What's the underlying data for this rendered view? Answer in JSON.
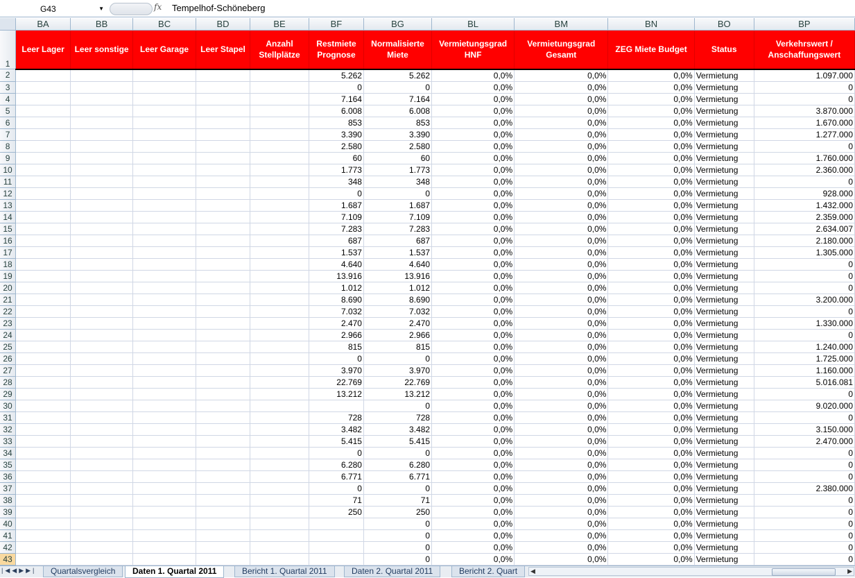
{
  "formula_bar": {
    "name_box": "G43",
    "fx_label": "fx",
    "formula_value": "Tempelhof-Schöneberg"
  },
  "columns": [
    {
      "letter": "BA",
      "header": "Leer Lager",
      "type": "txt"
    },
    {
      "letter": "BB",
      "header": "Leer sonstige",
      "type": "txt"
    },
    {
      "letter": "BC",
      "header": "Leer Garage",
      "type": "txt"
    },
    {
      "letter": "BD",
      "header": "Leer Stapel",
      "type": "txt"
    },
    {
      "letter": "BE",
      "header": "Anzahl Stellplätze",
      "type": "txt"
    },
    {
      "letter": "BF",
      "header": "Restmiete Prognose",
      "type": "num"
    },
    {
      "letter": "BG",
      "header": "Normalisierte Miete",
      "type": "num"
    },
    {
      "letter": "BL",
      "header": "Vermietungsgrad HNF",
      "type": "num"
    },
    {
      "letter": "BM",
      "header": "Vermietungsgrad Gesamt",
      "type": "num"
    },
    {
      "letter": "BN",
      "header": "ZEG Miete Budget",
      "type": "num"
    },
    {
      "letter": "BO",
      "header": "Status",
      "type": "txt"
    },
    {
      "letter": "BP",
      "header": "Verkehrswert / Anschaffungswert",
      "type": "num"
    }
  ],
  "header_row_number": "1",
  "rows": [
    {
      "n": "2",
      "bf": "5.262",
      "bg": "5.262",
      "bl": "0,0%",
      "bm": "0,0%",
      "bn": "0,0%",
      "bo": "Vermietung",
      "bp": "1.097.000"
    },
    {
      "n": "3",
      "bf": "0",
      "bg": "0",
      "bl": "0,0%",
      "bm": "0,0%",
      "bn": "0,0%",
      "bo": "Vermietung",
      "bp": "0"
    },
    {
      "n": "4",
      "bf": "7.164",
      "bg": "7.164",
      "bl": "0,0%",
      "bm": "0,0%",
      "bn": "0,0%",
      "bo": "Vermietung",
      "bp": "0"
    },
    {
      "n": "5",
      "bf": "6.008",
      "bg": "6.008",
      "bl": "0,0%",
      "bm": "0,0%",
      "bn": "0,0%",
      "bo": "Vermietung",
      "bp": "3.870.000"
    },
    {
      "n": "6",
      "bf": "853",
      "bg": "853",
      "bl": "0,0%",
      "bm": "0,0%",
      "bn": "0,0%",
      "bo": "Vermietung",
      "bp": "1.670.000"
    },
    {
      "n": "7",
      "bf": "3.390",
      "bg": "3.390",
      "bl": "0,0%",
      "bm": "0,0%",
      "bn": "0,0%",
      "bo": "Vermietung",
      "bp": "1.277.000"
    },
    {
      "n": "8",
      "bf": "2.580",
      "bg": "2.580",
      "bl": "0,0%",
      "bm": "0,0%",
      "bn": "0,0%",
      "bo": "Vermietung",
      "bp": "0"
    },
    {
      "n": "9",
      "bf": "60",
      "bg": "60",
      "bl": "0,0%",
      "bm": "0,0%",
      "bn": "0,0%",
      "bo": "Vermietung",
      "bp": "1.760.000"
    },
    {
      "n": "10",
      "bf": "1.773",
      "bg": "1.773",
      "bl": "0,0%",
      "bm": "0,0%",
      "bn": "0,0%",
      "bo": "Vermietung",
      "bp": "2.360.000"
    },
    {
      "n": "11",
      "bf": "348",
      "bg": "348",
      "bl": "0,0%",
      "bm": "0,0%",
      "bn": "0,0%",
      "bo": "Vermietung",
      "bp": "0"
    },
    {
      "n": "12",
      "bf": "0",
      "bg": "0",
      "bl": "0,0%",
      "bm": "0,0%",
      "bn": "0,0%",
      "bo": "Vermietung",
      "bp": "928.000"
    },
    {
      "n": "13",
      "bf": "1.687",
      "bg": "1.687",
      "bl": "0,0%",
      "bm": "0,0%",
      "bn": "0,0%",
      "bo": "Vermietung",
      "bp": "1.432.000"
    },
    {
      "n": "14",
      "bf": "7.109",
      "bg": "7.109",
      "bl": "0,0%",
      "bm": "0,0%",
      "bn": "0,0%",
      "bo": "Vermietung",
      "bp": "2.359.000"
    },
    {
      "n": "15",
      "bf": "7.283",
      "bg": "7.283",
      "bl": "0,0%",
      "bm": "0,0%",
      "bn": "0,0%",
      "bo": "Vermietung",
      "bp": "2.634.007"
    },
    {
      "n": "16",
      "bf": "687",
      "bg": "687",
      "bl": "0,0%",
      "bm": "0,0%",
      "bn": "0,0%",
      "bo": "Vermietung",
      "bp": "2.180.000"
    },
    {
      "n": "17",
      "bf": "1.537",
      "bg": "1.537",
      "bl": "0,0%",
      "bm": "0,0%",
      "bn": "0,0%",
      "bo": "Vermietung",
      "bp": "1.305.000"
    },
    {
      "n": "18",
      "bf": "4.640",
      "bg": "4.640",
      "bl": "0,0%",
      "bm": "0,0%",
      "bn": "0,0%",
      "bo": "Vermietung",
      "bp": "0"
    },
    {
      "n": "19",
      "bf": "13.916",
      "bg": "13.916",
      "bl": "0,0%",
      "bm": "0,0%",
      "bn": "0,0%",
      "bo": "Vermietung",
      "bp": "0"
    },
    {
      "n": "20",
      "bf": "1.012",
      "bg": "1.012",
      "bl": "0,0%",
      "bm": "0,0%",
      "bn": "0,0%",
      "bo": "Vermietung",
      "bp": "0"
    },
    {
      "n": "21",
      "bf": "8.690",
      "bg": "8.690",
      "bl": "0,0%",
      "bm": "0,0%",
      "bn": "0,0%",
      "bo": "Vermietung",
      "bp": "3.200.000"
    },
    {
      "n": "22",
      "bf": "7.032",
      "bg": "7.032",
      "bl": "0,0%",
      "bm": "0,0%",
      "bn": "0,0%",
      "bo": "Vermietung",
      "bp": "0"
    },
    {
      "n": "23",
      "bf": "2.470",
      "bg": "2.470",
      "bl": "0,0%",
      "bm": "0,0%",
      "bn": "0,0%",
      "bo": "Vermietung",
      "bp": "1.330.000"
    },
    {
      "n": "24",
      "bf": "2.966",
      "bg": "2.966",
      "bl": "0,0%",
      "bm": "0,0%",
      "bn": "0,0%",
      "bo": "Vermietung",
      "bp": "0"
    },
    {
      "n": "25",
      "bf": "815",
      "bg": "815",
      "bl": "0,0%",
      "bm": "0,0%",
      "bn": "0,0%",
      "bo": "Vermietung",
      "bp": "1.240.000"
    },
    {
      "n": "26",
      "bf": "0",
      "bg": "0",
      "bl": "0,0%",
      "bm": "0,0%",
      "bn": "0,0%",
      "bo": "Vermietung",
      "bp": "1.725.000"
    },
    {
      "n": "27",
      "bf": "3.970",
      "bg": "3.970",
      "bl": "0,0%",
      "bm": "0,0%",
      "bn": "0,0%",
      "bo": "Vermietung",
      "bp": "1.160.000"
    },
    {
      "n": "28",
      "bf": "22.769",
      "bg": "22.769",
      "bl": "0,0%",
      "bm": "0,0%",
      "bn": "0,0%",
      "bo": "Vermietung",
      "bp": "5.016.081"
    },
    {
      "n": "29",
      "bf": "13.212",
      "bg": "13.212",
      "bl": "0,0%",
      "bm": "0,0%",
      "bn": "0,0%",
      "bo": "Vermietung",
      "bp": "0"
    },
    {
      "n": "30",
      "bf": "",
      "bg": "0",
      "bl": "0,0%",
      "bm": "0,0%",
      "bn": "0,0%",
      "bo": "Vermietung",
      "bp": "9.020.000"
    },
    {
      "n": "31",
      "bf": "728",
      "bg": "728",
      "bl": "0,0%",
      "bm": "0,0%",
      "bn": "0,0%",
      "bo": "Vermietung",
      "bp": "0"
    },
    {
      "n": "32",
      "bf": "3.482",
      "bg": "3.482",
      "bl": "0,0%",
      "bm": "0,0%",
      "bn": "0,0%",
      "bo": "Vermietung",
      "bp": "3.150.000"
    },
    {
      "n": "33",
      "bf": "5.415",
      "bg": "5.415",
      "bl": "0,0%",
      "bm": "0,0%",
      "bn": "0,0%",
      "bo": "Vermietung",
      "bp": "2.470.000"
    },
    {
      "n": "34",
      "bf": "0",
      "bg": "0",
      "bl": "0,0%",
      "bm": "0,0%",
      "bn": "0,0%",
      "bo": "Vermietung",
      "bp": "0"
    },
    {
      "n": "35",
      "bf": "6.280",
      "bg": "6.280",
      "bl": "0,0%",
      "bm": "0,0%",
      "bn": "0,0%",
      "bo": "Vermietung",
      "bp": "0"
    },
    {
      "n": "36",
      "bf": "6.771",
      "bg": "6.771",
      "bl": "0,0%",
      "bm": "0,0%",
      "bn": "0,0%",
      "bo": "Vermietung",
      "bp": "0"
    },
    {
      "n": "37",
      "bf": "0",
      "bg": "0",
      "bl": "0,0%",
      "bm": "0,0%",
      "bn": "0,0%",
      "bo": "Vermietung",
      "bp": "2.380.000"
    },
    {
      "n": "38",
      "bf": "71",
      "bg": "71",
      "bl": "0,0%",
      "bm": "0,0%",
      "bn": "0,0%",
      "bo": "Vermietung",
      "bp": "0"
    },
    {
      "n": "39",
      "bf": "250",
      "bg": "250",
      "bl": "0,0%",
      "bm": "0,0%",
      "bn": "0,0%",
      "bo": "Vermietung",
      "bp": "0"
    },
    {
      "n": "40",
      "bf": "",
      "bg": "0",
      "bl": "0,0%",
      "bm": "0,0%",
      "bn": "0,0%",
      "bo": "Vermietung",
      "bp": "0"
    },
    {
      "n": "41",
      "bf": "",
      "bg": "0",
      "bl": "0,0%",
      "bm": "0,0%",
      "bn": "0,0%",
      "bo": "Vermietung",
      "bp": "0"
    },
    {
      "n": "42",
      "bf": "",
      "bg": "0",
      "bl": "0,0%",
      "bm": "0,0%",
      "bn": "0,0%",
      "bo": "Vermietung",
      "bp": "0"
    },
    {
      "n": "43",
      "bf": "",
      "bg": "0",
      "bl": "0,0%",
      "bm": "0,0%",
      "bn": "0,0%",
      "bo": "Vermietung",
      "bp": "0"
    }
  ],
  "selected_row": "43",
  "sheet_tabs": [
    {
      "label": "Quartalsvergleich",
      "active": false
    },
    {
      "label": "Daten 1. Quartal 2011",
      "active": true
    },
    {
      "label": "Bericht 1. Quartal 2011",
      "active": false
    },
    {
      "label": "Daten 2. Quartal 2011",
      "active": false
    },
    {
      "label": "Bericht 2. Quart",
      "active": false
    }
  ],
  "colors": {
    "header_fill": "#ff0000",
    "header_text": "#ffffff",
    "grid_line": "#d0d7e5",
    "selected_row": "#f9d99f"
  }
}
